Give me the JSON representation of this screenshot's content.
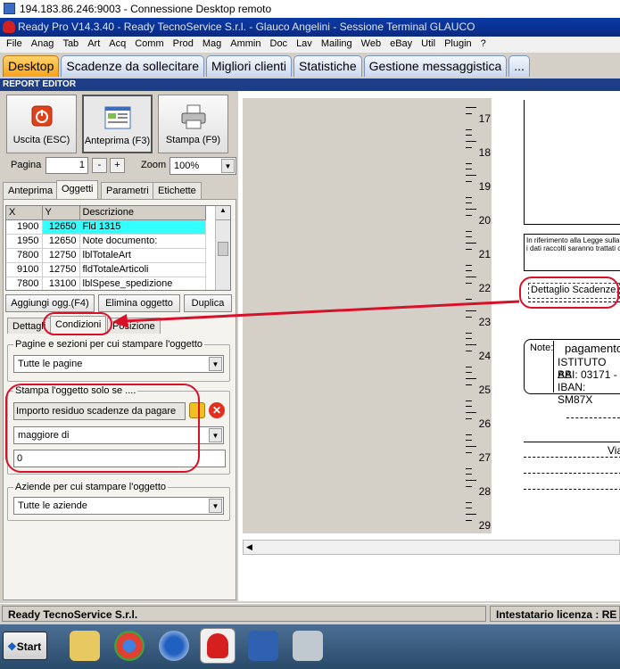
{
  "remote_title": "194.183.86.246:9003 - Connessione Desktop remoto",
  "app_title": "Ready Pro V14.3.40 - Ready TecnoService S.r.l. - Glauco Angelini - Sessione Terminal GLAUCO",
  "menu": [
    "File",
    "Anag",
    "Tab",
    "Art",
    "Acq",
    "Comm",
    "Prod",
    "Mag",
    "Ammin",
    "Doc",
    "Lav",
    "Mailing",
    "Web",
    "eBay",
    "Util",
    "Plugin",
    "?"
  ],
  "top_tabs": [
    "Desktop",
    "Scadenze da sollecitare",
    "Migliori clienti",
    "Statistiche",
    "Gestione messaggistica",
    "..."
  ],
  "report_editor_label": "REPORT EDITOR",
  "buttons": {
    "exit": "Uscita (ESC)",
    "preview": "Anteprima (F3)",
    "print": "Stampa (F9)"
  },
  "page": {
    "label": "Pagina",
    "value": "1",
    "minus": "-",
    "plus": "+"
  },
  "zoom": {
    "label": "Zoom",
    "value": "100%"
  },
  "sub_tabs": [
    "Anteprima",
    "Oggetti",
    "Parametri",
    "Etichette"
  ],
  "grid": {
    "headers": [
      "X",
      "Y",
      "Descrizione"
    ],
    "rows": [
      [
        "1900",
        "12650",
        "Fld 1315"
      ],
      [
        "1950",
        "12650",
        "Note documento:"
      ],
      [
        "7800",
        "12750",
        "lblTotaleArt"
      ],
      [
        "9100",
        "12750",
        "fldTotaleArticoli"
      ],
      [
        "7800",
        "13100",
        "lblSpese_spedizione"
      ]
    ]
  },
  "actions": {
    "add": "Aggiungi ogg.(F4)",
    "delete": "Elimina oggetto",
    "duplicate": "Duplica"
  },
  "detail_tabs": [
    "Dettagli",
    "Condizioni",
    "Posizione"
  ],
  "group_pages": {
    "caption": "Pagine e sezioni per cui stampare l'oggetto",
    "value": "Tutte le pagine"
  },
  "group_cond": {
    "caption": "Stampa l'oggetto solo se ....",
    "field": "Importo residuo scadenze da pagare",
    "operator": "maggiore di",
    "value": "0"
  },
  "group_companies": {
    "caption": "Aziende per cui stampare l'oggetto",
    "value": "Tutte le aziende"
  },
  "ruler": [
    "17",
    "18",
    "19",
    "20",
    "21",
    "22",
    "23",
    "24",
    "25",
    "26",
    "27",
    "28",
    "29"
  ],
  "paper": {
    "detail_label": "Dettaglio Scadenze.",
    "note_label": "Note:",
    "payment": "pagamento",
    "bank": "ISTITUTO BA",
    "abi": "ABI: 03171 -",
    "iban": "IBAN: SM87X",
    "via": "Via",
    "dense1": "In riferimento alla Legge sulla privacy",
    "dense2": "i dati raccolti saranno trattati con procedure informatiche"
  },
  "status": {
    "company": "Ready TecnoService S.r.l.",
    "license": "Intestatario licenza : RE"
  },
  "taskbar": {
    "start": "Start"
  },
  "colors": {
    "accent": "#f7a21b",
    "highlight_row": "#33ffff",
    "annotation": "#d8102a",
    "title_bar": "#0a3aa6"
  }
}
